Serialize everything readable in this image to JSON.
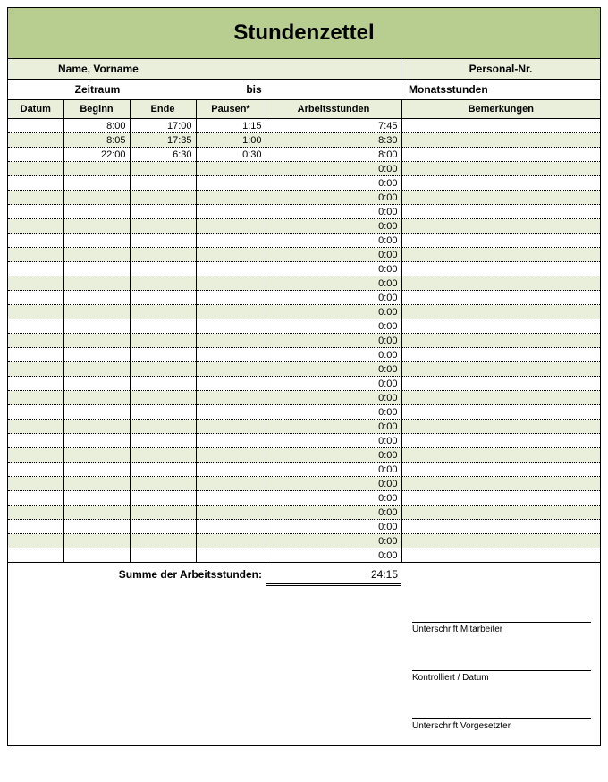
{
  "title": "Stundenzettel",
  "labels": {
    "name": "Name, Vorname",
    "personal_nr": "Personal-Nr.",
    "zeitraum": "Zeitraum",
    "bis": "bis",
    "monatsstunden": "Monatsstunden",
    "datum": "Datum",
    "beginn": "Beginn",
    "ende": "Ende",
    "pausen": "Pausen*",
    "arbeitsstunden": "Arbeitsstunden",
    "bemerkungen": "Bemerkungen",
    "summe": "Summe der Arbeitsstunden:",
    "sig_mitarbeiter": "Unterschrift Mitarbeiter",
    "sig_kontrolliert": "Kontrolliert / Datum",
    "sig_vorgesetzter": "Unterschrift Vorgesetzter"
  },
  "rows": [
    {
      "datum": "",
      "beginn": "8:00",
      "ende": "17:00",
      "pausen": "1:15",
      "arbeit": "7:45",
      "bemerk": ""
    },
    {
      "datum": "",
      "beginn": "8:05",
      "ende": "17:35",
      "pausen": "1:00",
      "arbeit": "8:30",
      "bemerk": ""
    },
    {
      "datum": "",
      "beginn": "22:00",
      "ende": "6:30",
      "pausen": "0:30",
      "arbeit": "8:00",
      "bemerk": ""
    },
    {
      "datum": "",
      "beginn": "",
      "ende": "",
      "pausen": "",
      "arbeit": "0:00",
      "bemerk": ""
    },
    {
      "datum": "",
      "beginn": "",
      "ende": "",
      "pausen": "",
      "arbeit": "0:00",
      "bemerk": ""
    },
    {
      "datum": "",
      "beginn": "",
      "ende": "",
      "pausen": "",
      "arbeit": "0:00",
      "bemerk": ""
    },
    {
      "datum": "",
      "beginn": "",
      "ende": "",
      "pausen": "",
      "arbeit": "0:00",
      "bemerk": ""
    },
    {
      "datum": "",
      "beginn": "",
      "ende": "",
      "pausen": "",
      "arbeit": "0:00",
      "bemerk": ""
    },
    {
      "datum": "",
      "beginn": "",
      "ende": "",
      "pausen": "",
      "arbeit": "0:00",
      "bemerk": ""
    },
    {
      "datum": "",
      "beginn": "",
      "ende": "",
      "pausen": "",
      "arbeit": "0:00",
      "bemerk": ""
    },
    {
      "datum": "",
      "beginn": "",
      "ende": "",
      "pausen": "",
      "arbeit": "0:00",
      "bemerk": ""
    },
    {
      "datum": "",
      "beginn": "",
      "ende": "",
      "pausen": "",
      "arbeit": "0:00",
      "bemerk": ""
    },
    {
      "datum": "",
      "beginn": "",
      "ende": "",
      "pausen": "",
      "arbeit": "0:00",
      "bemerk": ""
    },
    {
      "datum": "",
      "beginn": "",
      "ende": "",
      "pausen": "",
      "arbeit": "0:00",
      "bemerk": ""
    },
    {
      "datum": "",
      "beginn": "",
      "ende": "",
      "pausen": "",
      "arbeit": "0:00",
      "bemerk": ""
    },
    {
      "datum": "",
      "beginn": "",
      "ende": "",
      "pausen": "",
      "arbeit": "0:00",
      "bemerk": ""
    },
    {
      "datum": "",
      "beginn": "",
      "ende": "",
      "pausen": "",
      "arbeit": "0:00",
      "bemerk": ""
    },
    {
      "datum": "",
      "beginn": "",
      "ende": "",
      "pausen": "",
      "arbeit": "0:00",
      "bemerk": ""
    },
    {
      "datum": "",
      "beginn": "",
      "ende": "",
      "pausen": "",
      "arbeit": "0:00",
      "bemerk": ""
    },
    {
      "datum": "",
      "beginn": "",
      "ende": "",
      "pausen": "",
      "arbeit": "0:00",
      "bemerk": ""
    },
    {
      "datum": "",
      "beginn": "",
      "ende": "",
      "pausen": "",
      "arbeit": "0:00",
      "bemerk": ""
    },
    {
      "datum": "",
      "beginn": "",
      "ende": "",
      "pausen": "",
      "arbeit": "0:00",
      "bemerk": ""
    },
    {
      "datum": "",
      "beginn": "",
      "ende": "",
      "pausen": "",
      "arbeit": "0:00",
      "bemerk": ""
    },
    {
      "datum": "",
      "beginn": "",
      "ende": "",
      "pausen": "",
      "arbeit": "0:00",
      "bemerk": ""
    },
    {
      "datum": "",
      "beginn": "",
      "ende": "",
      "pausen": "",
      "arbeit": "0:00",
      "bemerk": ""
    },
    {
      "datum": "",
      "beginn": "",
      "ende": "",
      "pausen": "",
      "arbeit": "0:00",
      "bemerk": ""
    },
    {
      "datum": "",
      "beginn": "",
      "ende": "",
      "pausen": "",
      "arbeit": "0:00",
      "bemerk": ""
    },
    {
      "datum": "",
      "beginn": "",
      "ende": "",
      "pausen": "",
      "arbeit": "0:00",
      "bemerk": ""
    },
    {
      "datum": "",
      "beginn": "",
      "ende": "",
      "pausen": "",
      "arbeit": "0:00",
      "bemerk": ""
    },
    {
      "datum": "",
      "beginn": "",
      "ende": "",
      "pausen": "",
      "arbeit": "0:00",
      "bemerk": ""
    },
    {
      "datum": "",
      "beginn": "",
      "ende": "",
      "pausen": "",
      "arbeit": "0:00",
      "bemerk": ""
    }
  ],
  "summe_value": "24:15"
}
